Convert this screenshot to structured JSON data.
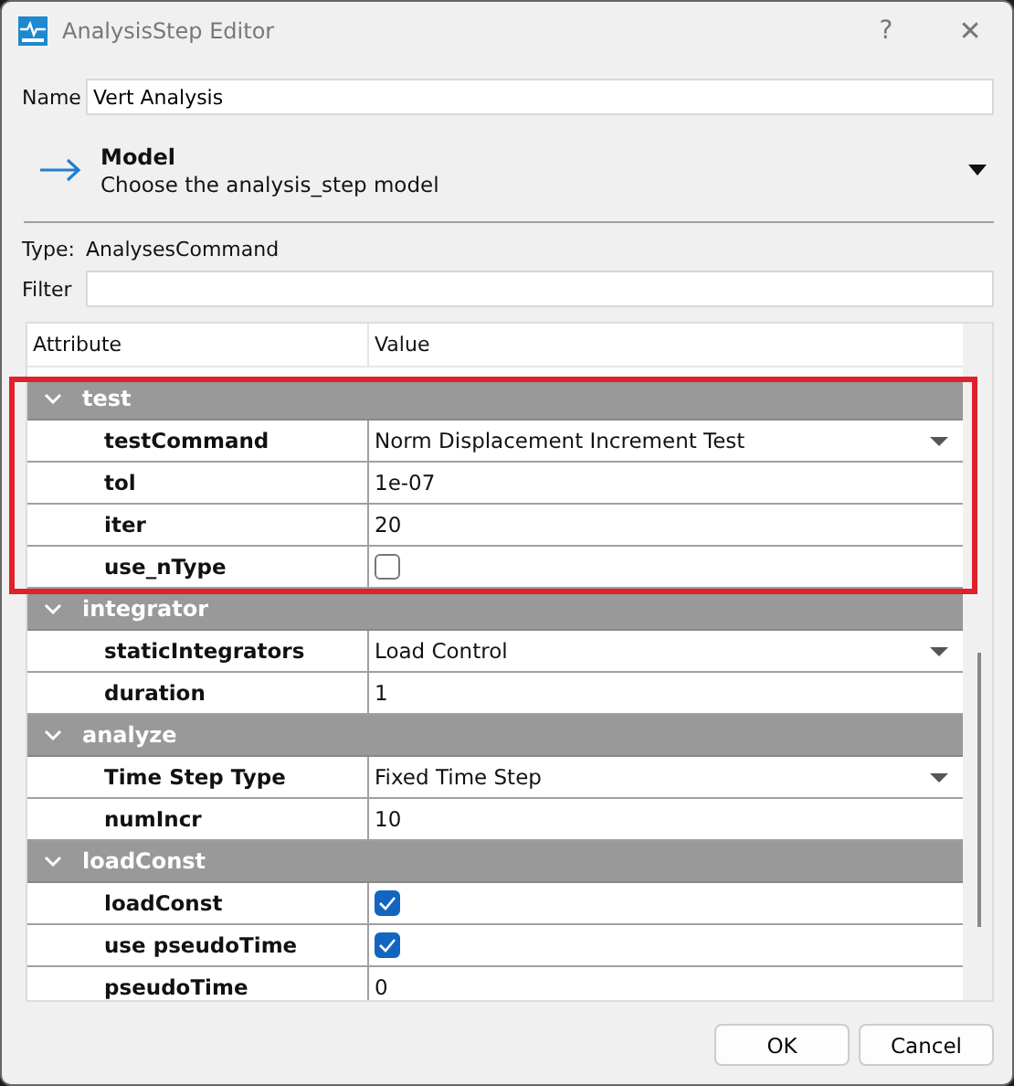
{
  "window": {
    "title": "AnalysisStep Editor",
    "help": "?",
    "close": "✕"
  },
  "name_field": {
    "label": "Name",
    "value": "Vert Analysis"
  },
  "model": {
    "title": "Model",
    "description": "Choose the analysis_step model",
    "expanded": false
  },
  "type": {
    "label": "Type:",
    "value": "AnalysesCommand"
  },
  "filter": {
    "label": "Filter"
  },
  "table": {
    "columns": [
      "Attribute",
      "Value"
    ],
    "groups": [
      {
        "name": "test",
        "expanded": true,
        "highlighted": true,
        "rows": [
          {
            "label": "testCommand",
            "kind": "dropdown",
            "value": "Norm Displacement Increment Test"
          },
          {
            "label": "tol",
            "kind": "text",
            "value": "1e-07"
          },
          {
            "label": "iter",
            "kind": "text",
            "value": "20"
          },
          {
            "label": "use_nType",
            "kind": "checkbox",
            "checked": false
          }
        ]
      },
      {
        "name": "integrator",
        "expanded": true,
        "highlighted": false,
        "rows": [
          {
            "label": "staticIntegrators",
            "kind": "dropdown",
            "value": "Load Control"
          },
          {
            "label": "duration",
            "kind": "text",
            "value": "1"
          }
        ]
      },
      {
        "name": "analyze",
        "expanded": true,
        "highlighted": false,
        "rows": [
          {
            "label": "Time Step Type",
            "kind": "dropdown",
            "value": "Fixed Time Step"
          },
          {
            "label": "numIncr",
            "kind": "text",
            "value": "10"
          }
        ]
      },
      {
        "name": "loadConst",
        "expanded": true,
        "highlighted": false,
        "rows": [
          {
            "label": "loadConst",
            "kind": "checkbox",
            "checked": true
          },
          {
            "label": "use pseudoTime",
            "kind": "checkbox",
            "checked": true
          },
          {
            "label": "pseudoTime",
            "kind": "text",
            "value": "0"
          }
        ]
      }
    ]
  },
  "buttons": [
    "OK",
    "Cancel"
  ]
}
